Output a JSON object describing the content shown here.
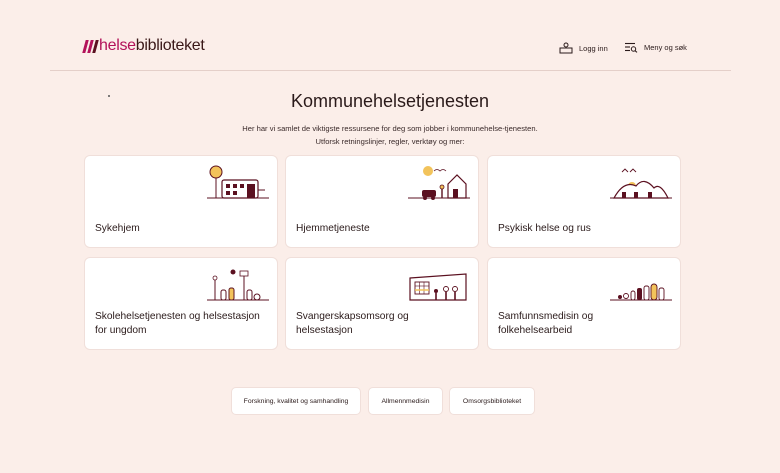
{
  "header": {
    "logo": {
      "part1": "helse",
      "part2": "biblioteket"
    },
    "login_label": "Logg inn",
    "menu_label": "Meny og søk"
  },
  "main": {
    "title": "Kommunehelsetjenesten",
    "intro": "Her har vi samlet de viktigste ressursene for deg som jobber i kommunehelse-tjenesten. Utforsk retningslinjer, regler, verktøy og mer:"
  },
  "cards": [
    {
      "label": "Sykehjem",
      "icon": "nursing-home-icon"
    },
    {
      "label": "Hjemmetjeneste",
      "icon": "home-care-icon"
    },
    {
      "label": "Psykisk helse og rus",
      "icon": "mental-health-icon"
    },
    {
      "label": "Skolehelsetjenesten og helsestasjon for ungdom",
      "icon": "school-health-icon"
    },
    {
      "label": "Svangerskapsomsorg og helsestasjon",
      "icon": "maternity-care-icon"
    },
    {
      "label": "Samfunnsmedisin og folkehelsearbeid",
      "icon": "public-health-icon"
    }
  ],
  "links": [
    {
      "label": "Forskning, kvalitet og samhandling"
    },
    {
      "label": "Allmennmedisin"
    },
    {
      "label": "Omsorgsbiblioteket"
    }
  ],
  "colors": {
    "background": "#fbeee9",
    "brand": "#b3125a",
    "dark": "#5b1020",
    "accent": "#f2c35b"
  }
}
